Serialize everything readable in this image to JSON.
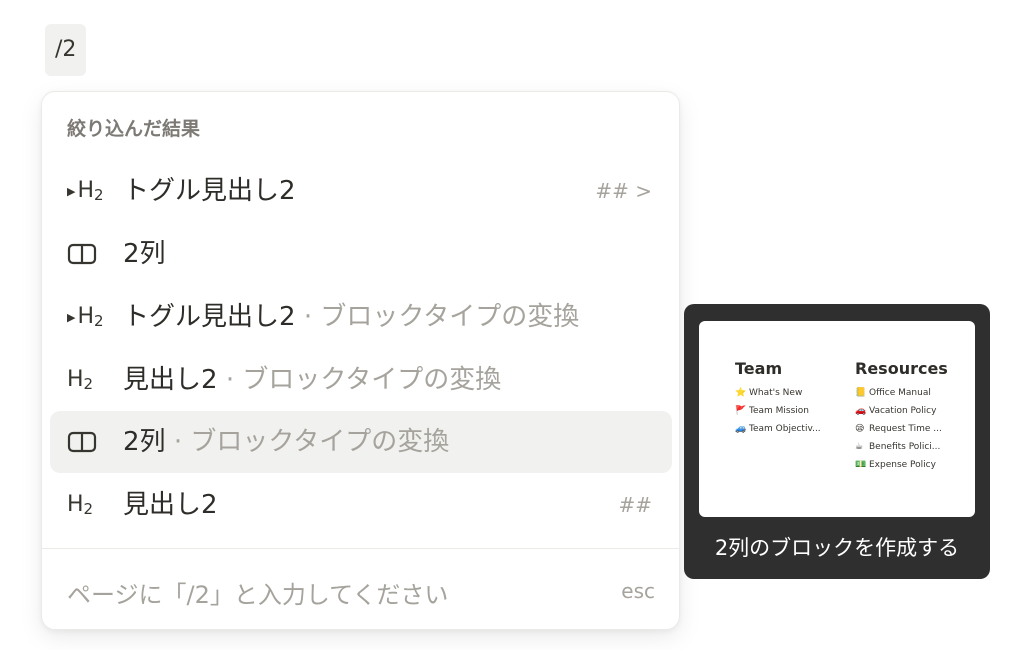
{
  "query": "/2",
  "menu": {
    "header": "絞り込んだ結果",
    "items": [
      {
        "icon": "toggle-heading-2-icon",
        "icon_h": "H",
        "icon_n": "2",
        "label": "トグル見出し2",
        "sub": "",
        "shortcut": "## >"
      },
      {
        "icon": "columns-icon",
        "label": "2列",
        "sub": "",
        "shortcut": ""
      },
      {
        "icon": "toggle-heading-2-icon",
        "icon_h": "H",
        "icon_n": "2",
        "label": "トグル見出し2",
        "sub": "ブロックタイプの変換",
        "shortcut": ""
      },
      {
        "icon": "heading-2-icon",
        "icon_h": "H",
        "icon_n": "2",
        "label": "見出し2",
        "sub": "ブロックタイプの変換",
        "shortcut": ""
      },
      {
        "icon": "columns-icon",
        "label": "2列",
        "sub": "ブロックタイプの変換",
        "shortcut": "",
        "hovered": true
      },
      {
        "icon": "heading-2-icon",
        "icon_h": "H",
        "icon_n": "2",
        "label": "見出し2",
        "sub": "",
        "shortcut": "##"
      }
    ],
    "separator": "·",
    "footer_text": "ページに「/2」と入力してください",
    "footer_esc": "esc"
  },
  "preview": {
    "caption": "2列のブロックを作成する",
    "left_col": {
      "title": "Team",
      "items": [
        {
          "emoji": "⭐",
          "text": "What's New"
        },
        {
          "emoji": "🚩",
          "text": "Team Mission"
        },
        {
          "emoji": "🚙",
          "text": "Team Objectiv..."
        }
      ]
    },
    "right_col": {
      "title": "Resources",
      "items": [
        {
          "emoji": "📒",
          "text": "Office Manual"
        },
        {
          "emoji": "🚗",
          "text": "Vacation Policy"
        },
        {
          "emoji": "😪",
          "text": "Request Time ..."
        },
        {
          "emoji": "☕",
          "text": "Benefits Polici..."
        },
        {
          "emoji": "💵",
          "text": "Expense Policy"
        }
      ]
    }
  },
  "colors": {
    "text": "#37352f",
    "muted": "#a6a39d",
    "hover_bg": "#f1f1ef",
    "preview_bg": "#2f2f2f"
  }
}
